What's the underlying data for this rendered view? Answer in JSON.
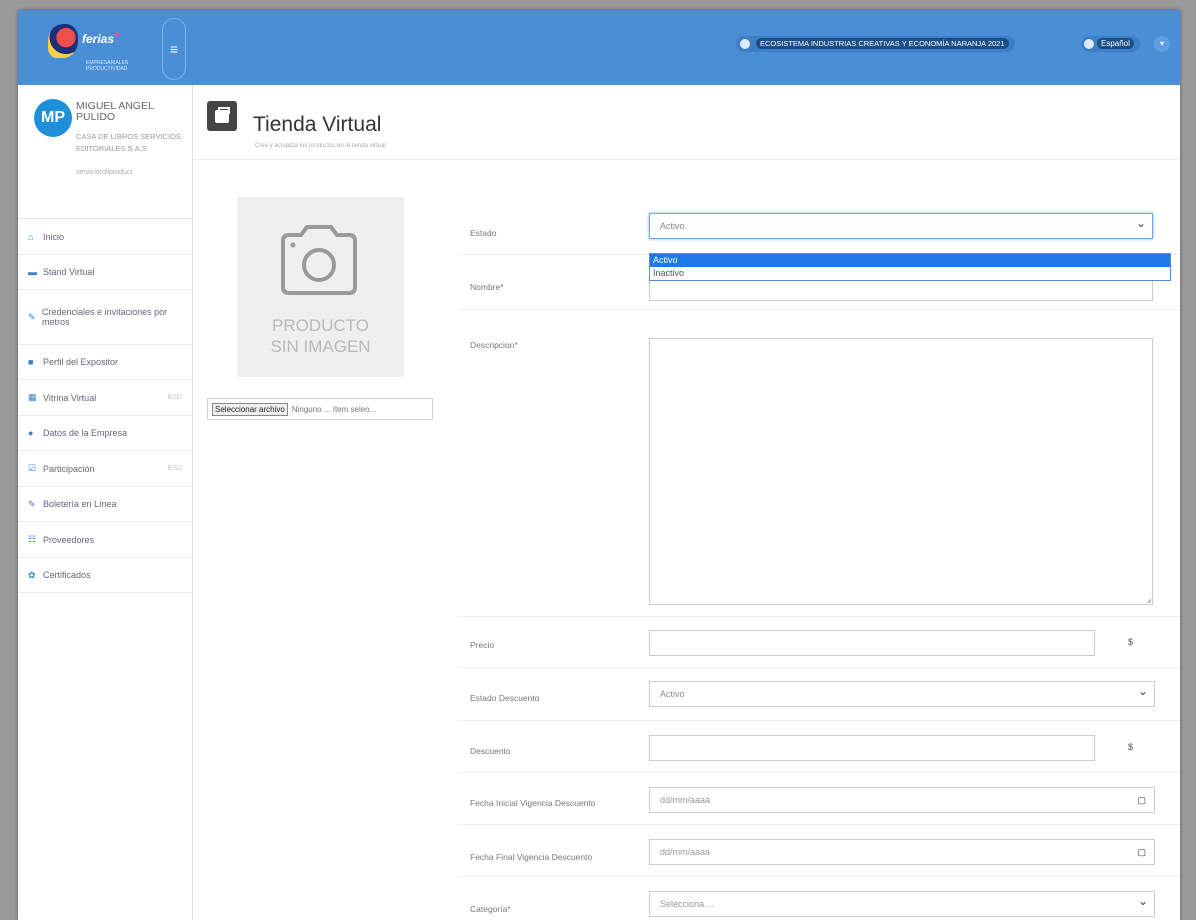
{
  "header": {
    "logo_text": "ferias",
    "logo_sup": "+",
    "logo_sub": "EMPRESARIALES PRODUCTIVIDAD",
    "event": "ECOSISTEMA INDUSTRIAS CREATIVAS Y ECONOMÍA NARANJA 2021",
    "language": "Español"
  },
  "user": {
    "initials": "MP",
    "name": "MIGUEL ANGEL PULIDO",
    "company": "CASA DE LIBROS SERVICIOS EDITORIALES S.A.S",
    "role": "servicioroliproduct"
  },
  "sidebar": {
    "items": [
      {
        "icon": "home-icon",
        "glyph": "⌂",
        "label": "Inicio",
        "badge": ""
      },
      {
        "icon": "folder-icon",
        "glyph": "▬",
        "label": "Stand Virtual",
        "badge": ""
      },
      {
        "icon": "key-icon",
        "glyph": "✎",
        "label": "Credenciales e invitaciones por metros",
        "badge": ""
      },
      {
        "icon": "briefcase-icon",
        "glyph": "■",
        "label": "Perfil del Expositor",
        "badge": ""
      },
      {
        "icon": "calendar-icon",
        "glyph": "▦",
        "label": "Vitrina Virtual",
        "badge": "BSD"
      },
      {
        "icon": "info-icon",
        "glyph": "●",
        "label": "Datos de la Empresa",
        "badge": ""
      },
      {
        "icon": "edit-icon",
        "glyph": "☑",
        "label": "Participación",
        "badge": "BSD"
      },
      {
        "icon": "ticket-icon",
        "glyph": "✎",
        "label": "Boletería en Línea",
        "badge": ""
      },
      {
        "icon": "list-icon",
        "glyph": "☷",
        "label": "Proveedores",
        "badge": ""
      },
      {
        "icon": "certificate-icon",
        "glyph": "✿",
        "label": "Certificados",
        "badge": ""
      }
    ]
  },
  "page": {
    "title": "Tienda Virtual",
    "subtitle": "Crea y actualiza los productos en la tienda virtual"
  },
  "image": {
    "placeholder_line1": "PRODUCTO",
    "placeholder_line2": "SIN IMAGEN",
    "file_button": "Seleccionar archivo",
    "file_status": "Ninguno ... ítem seleo..."
  },
  "form": {
    "estado_label": "Estado",
    "estado_value": "Activo",
    "estado_options": [
      "Activo",
      "Inactivo"
    ],
    "nombre_label": "Nombre*",
    "descripcion_label": "Descripcion*",
    "precio_label": "Precio",
    "precio_unit": "$",
    "estado_descuento_label": "Estado Descuento",
    "estado_descuento_value": "Activo",
    "descuento_label": "Descuento",
    "descuento_unit": "$",
    "fecha_inicial_label": "Fecha Inicial Vigencia Descuento",
    "fecha_inicial_placeholder": "dd/mm/aaaa",
    "fecha_final_label": "Fecha Final Vigencia Descuento",
    "fecha_final_placeholder": "dd/mm/aaaa",
    "categoria_label": "Categoría*",
    "categoria_value": "Selecciona ..."
  },
  "colors": {
    "topbar": "#4a8fd6",
    "accent": "#1e78e8",
    "avatar": "#1e8fd8"
  }
}
